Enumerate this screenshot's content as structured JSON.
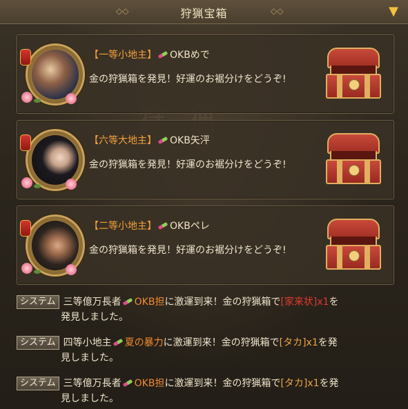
{
  "header": {
    "title": "狩猟宝箱",
    "collapse_icon": "chevron-down-icon"
  },
  "cards": [
    {
      "rank": "【一等小地主】",
      "player": "OKBめで",
      "message": "金の狩猟箱を発見！好運のお裾分けをどうぞ!",
      "icon": "treasure-chest-icon"
    },
    {
      "rank": "【六等大地主】",
      "player": "OKB矢泙",
      "message": "金の狩猟箱を発見！好運のお裾分けをどうぞ!",
      "icon": "treasure-chest-icon"
    },
    {
      "rank": "【二等小地主】",
      "player": "OKBペレ",
      "message": "金の狩猟箱を発見！好運のお裾分けをどうぞ!",
      "icon": "treasure-chest-icon"
    }
  ],
  "system_messages": [
    {
      "badge": "システム",
      "rank": "三等億万長者",
      "player": "OKB担",
      "text_a": "に激運到来！金の狩猟箱で",
      "item": "[家来状]x1",
      "text_b": "を",
      "line2": "発見しました。"
    },
    {
      "badge": "システム",
      "rank": "四等小地主",
      "player": "夏の暴力",
      "text_a": "に激運到来！金の狩猟箱で",
      "item": "[タカ]x1",
      "text_b": "を発",
      "line2": "見しました。"
    },
    {
      "badge": "システム",
      "rank": "三等億万長者",
      "player": "OKB担",
      "text_a": "に激運到来！金の狩猟箱で",
      "item": "[タカ]x1",
      "text_b": "を発",
      "line2": "見しました。"
    }
  ],
  "colors": {
    "rank_orange": "#f2a13a",
    "player_orange": "#f28a2e",
    "item_red": "#e23a2c",
    "item_yellow": "#f0a640",
    "accent_gold": "#f2c23a"
  }
}
